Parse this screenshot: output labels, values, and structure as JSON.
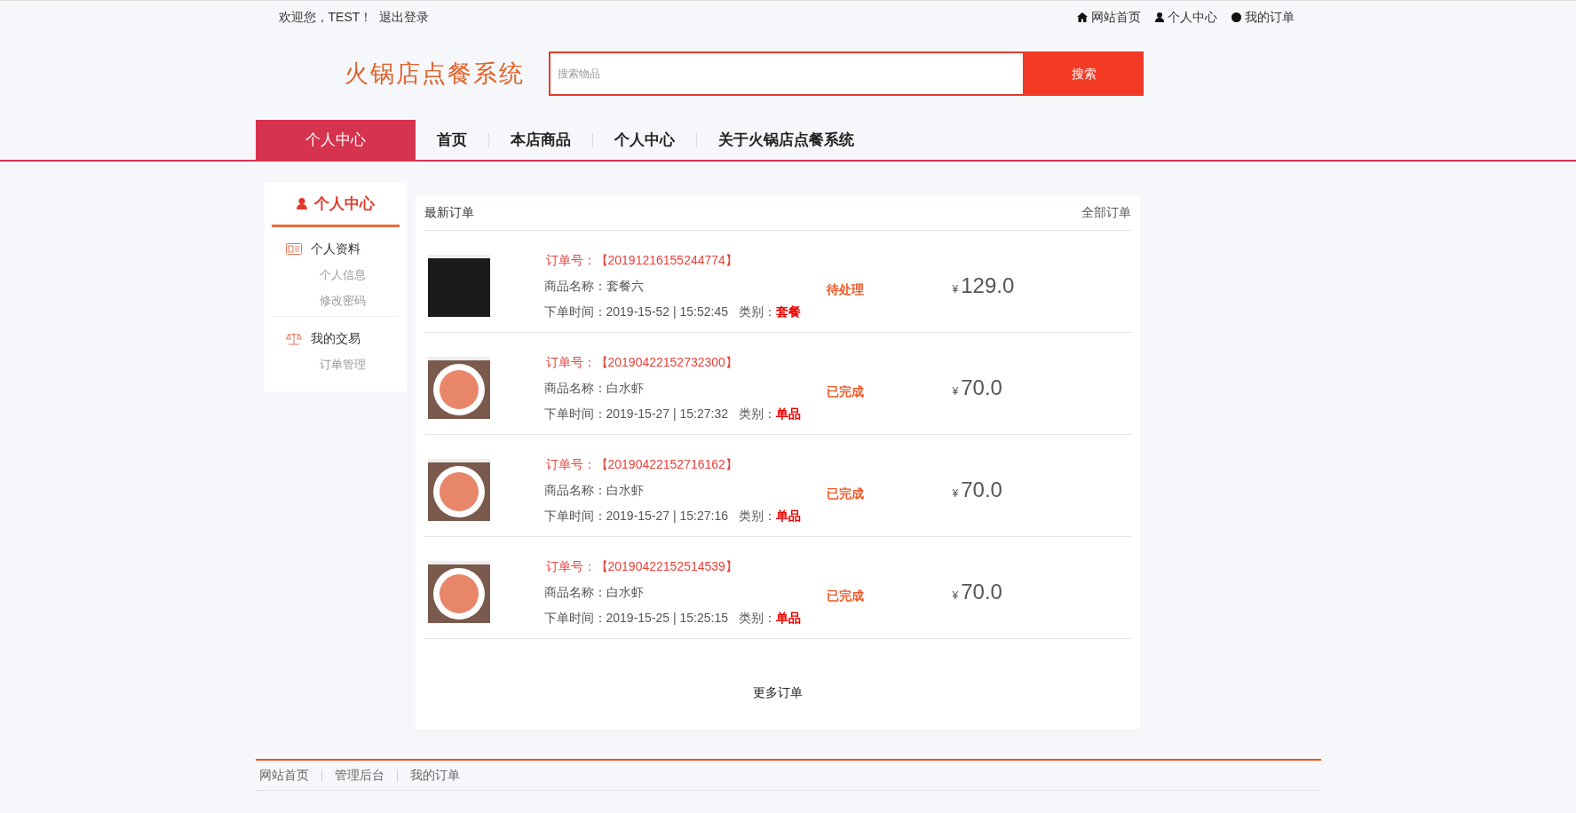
{
  "top_bar": {
    "greeting": "欢迎您，TEST！",
    "logout": "退出登录",
    "links": [
      {
        "kind": "home",
        "label": "网站首页"
      },
      {
        "kind": "user",
        "label": "个人中心"
      },
      {
        "kind": "dot",
        "label": "我的订单"
      }
    ]
  },
  "header": {
    "logo": "火锅店点餐系统",
    "search": {
      "placeholder": "搜索物品",
      "button": "搜索"
    }
  },
  "nav": {
    "current": "个人中心",
    "items": [
      "首页",
      "本店商品",
      "个人中心",
      "关于火锅店点餐系统"
    ]
  },
  "sidebar": {
    "title": "个人中心",
    "groups": [
      {
        "kind": "profile",
        "label": "个人资料",
        "items": [
          "个人信息",
          "修改密码"
        ]
      },
      {
        "kind": "trade",
        "label": "我的交易",
        "items": [
          "订单管理"
        ]
      }
    ]
  },
  "orders": {
    "title": "最新订单",
    "all_link": "全部订单",
    "more": "更多订单",
    "rows": [
      {
        "kind": "platter",
        "order_no": "订单号：【20191216155244774】",
        "product": "商品名称：套餐六",
        "time": "下单时间：2019-15-52 | 15:52:45",
        "category_label": "类别：",
        "category": "套餐",
        "status": "待处理",
        "currency": "¥",
        "amount": "129.0"
      },
      {
        "kind": "shrimp",
        "order_no": "订单号：【20190422152732300】",
        "product": "商品名称：白水虾",
        "time": "下单时间：2019-15-27 | 15:27:32",
        "category_label": "类别：",
        "category": "单品",
        "status": "已完成",
        "currency": "¥",
        "amount": "70.0"
      },
      {
        "kind": "shrimp",
        "order_no": "订单号：【20190422152716162】",
        "product": "商品名称：白水虾",
        "time": "下单时间：2019-15-27 | 15:27:16",
        "category_label": "类别：",
        "category": "单品",
        "status": "已完成",
        "currency": "¥",
        "amount": "70.0"
      },
      {
        "kind": "shrimp",
        "order_no": "订单号：【20190422152514539】",
        "product": "商品名称：白水虾",
        "time": "下单时间：2019-15-25 | 15:25:15",
        "category_label": "类别：",
        "category": "单品",
        "status": "已完成",
        "currency": "¥",
        "amount": "70.0"
      }
    ]
  },
  "footer": {
    "links": [
      "网站首页",
      "管理后台",
      "我的订单"
    ]
  }
}
